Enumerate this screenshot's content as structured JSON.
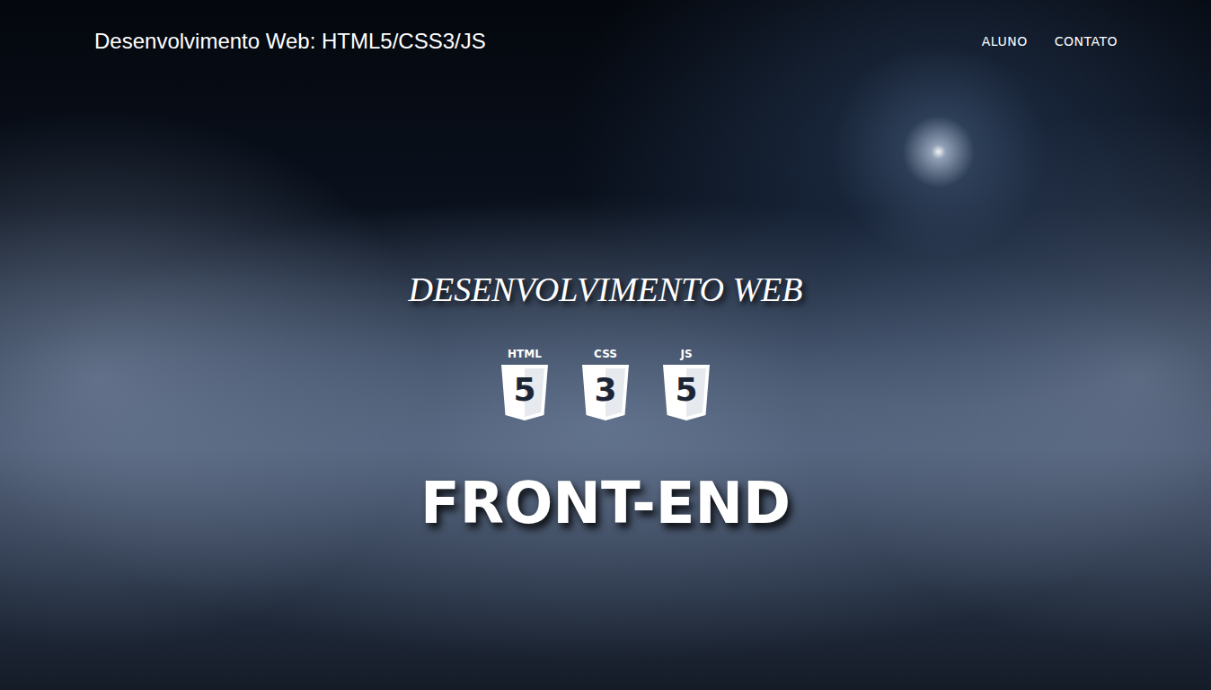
{
  "header": {
    "brand": "Desenvolvimento Web: HTML5/CSS3/JS",
    "nav": [
      "ALUNO",
      "CONTATO"
    ]
  },
  "hero": {
    "subtitle": "DESENVOLVIMENTO WEB",
    "badges": [
      {
        "label": "HTML",
        "number": "5"
      },
      {
        "label": "CSS",
        "number": "3"
      },
      {
        "label": "JS",
        "number": "5"
      }
    ],
    "title": "FRONT-END"
  }
}
